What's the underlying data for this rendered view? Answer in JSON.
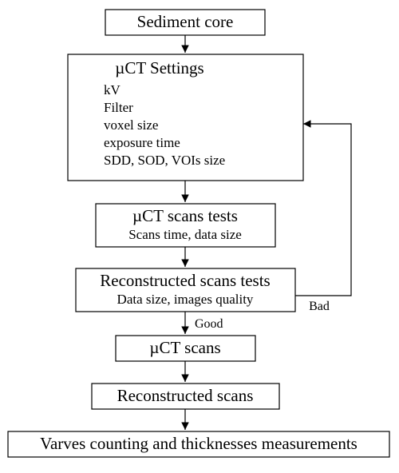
{
  "nodes": {
    "sediment": {
      "title": "Sediment core"
    },
    "settings": {
      "title": "µCT Settings",
      "items": [
        "kV",
        "Filter",
        "voxel size",
        "exposure time",
        "SDD, SOD, VOIs size"
      ]
    },
    "scans_tests": {
      "title": "µCT scans tests",
      "sub": "Scans time, data size"
    },
    "recon_tests": {
      "title": "Reconstructed scans tests",
      "sub": "Data size, images quality"
    },
    "scans": {
      "title": "µCT scans"
    },
    "recon": {
      "title": "Reconstructed scans"
    },
    "varves": {
      "title": "Varves counting and thicknesses measurements"
    }
  },
  "edges": {
    "good": "Good",
    "bad": "Bad"
  }
}
